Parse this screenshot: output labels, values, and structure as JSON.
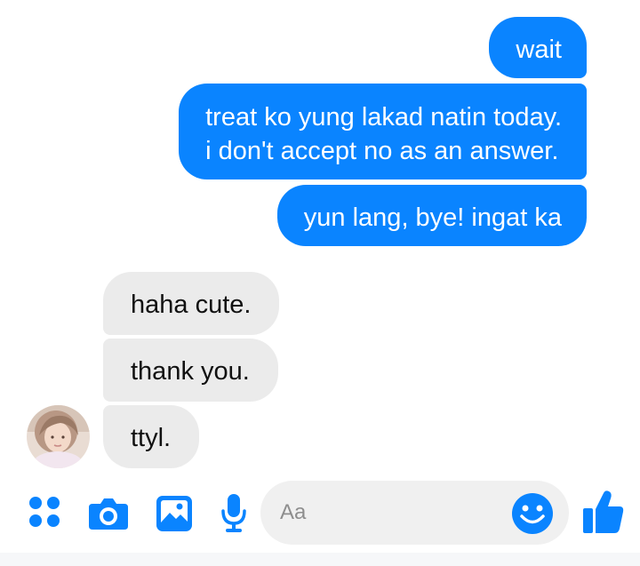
{
  "colors": {
    "accent": "#0a84ff",
    "incoming_bubble": "#ebebeb",
    "input_background": "#f0f0f0"
  },
  "messages": [
    {
      "direction": "outgoing",
      "text": "wait"
    },
    {
      "direction": "outgoing",
      "text": "treat ko yung lakad natin today.\ni don't accept no as an answer."
    },
    {
      "direction": "outgoing",
      "text": "yun lang, bye! ingat ka"
    },
    {
      "direction": "incoming",
      "text": "haha cute."
    },
    {
      "direction": "incoming",
      "text": "thank you."
    },
    {
      "direction": "incoming",
      "text": "ttyl."
    }
  ],
  "composer": {
    "placeholder": "Aa",
    "icons": [
      "more-apps-icon",
      "camera-icon",
      "gallery-icon",
      "microphone-icon",
      "emoji-icon",
      "thumbs-up-icon"
    ]
  }
}
